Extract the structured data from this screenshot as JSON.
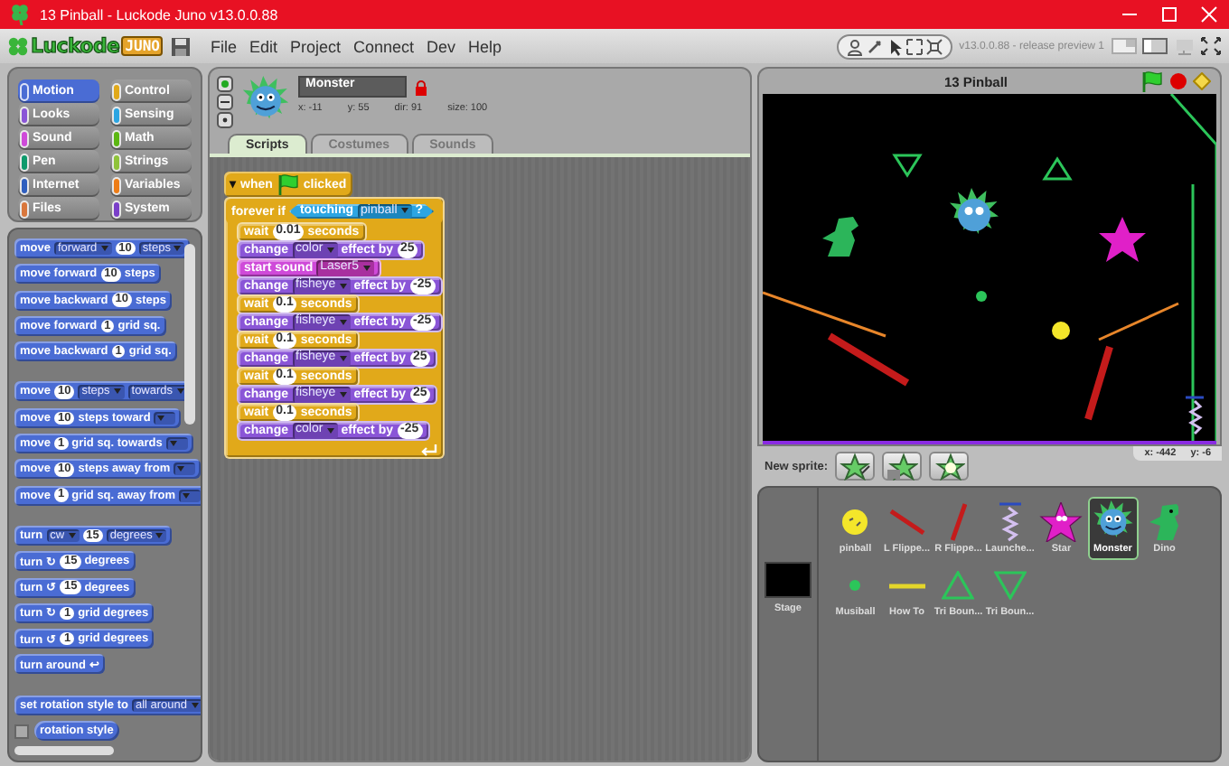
{
  "window": {
    "title": "13 Pinball - Luckode Juno v13.0.0.88"
  },
  "toolbar": {
    "logo": "Luckode",
    "logo_badge": "JUNO",
    "menu": [
      "File",
      "Edit",
      "Project",
      "Connect",
      "Dev",
      "Help"
    ],
    "version": "v13.0.0.88 - release preview 1"
  },
  "categories": [
    {
      "label": "Motion",
      "color": "#4a6cd4",
      "selected": true
    },
    {
      "label": "Control",
      "color": "#e1a91a",
      "selected": false
    },
    {
      "label": "Looks",
      "color": "#8a55d7",
      "selected": false
    },
    {
      "label": "Sensing",
      "color": "#2ca5e2",
      "selected": false
    },
    {
      "label": "Sound",
      "color": "#cf4ad9",
      "selected": false
    },
    {
      "label": "Math",
      "color": "#5cb712",
      "selected": false
    },
    {
      "label": "Pen",
      "color": "#0e9a6c",
      "selected": false
    },
    {
      "label": "Strings",
      "color": "#8fc33a",
      "selected": false
    },
    {
      "label": "Internet",
      "color": "#2f5fbf",
      "selected": false
    },
    {
      "label": "Variables",
      "color": "#ee7d16",
      "selected": false
    },
    {
      "label": "Files",
      "color": "#d9773c",
      "selected": false
    },
    {
      "label": "System",
      "color": "#7a3fc9",
      "selected": false
    }
  ],
  "palette": {
    "groups": [
      [
        {
          "kind": "motion",
          "parts": [
            {
              "kind": "label",
              "text": "move"
            },
            {
              "kind": "menu",
              "text": "forward"
            },
            {
              "kind": "number",
              "text": "10"
            },
            {
              "kind": "menu",
              "text": "steps"
            }
          ]
        },
        {
          "kind": "motion",
          "parts": [
            {
              "kind": "label",
              "text": "move forward"
            },
            {
              "kind": "number",
              "text": "10"
            },
            {
              "kind": "label",
              "text": "steps"
            }
          ]
        },
        {
          "kind": "motion",
          "parts": [
            {
              "kind": "label",
              "text": "move backward"
            },
            {
              "kind": "number",
              "text": "10"
            },
            {
              "kind": "label",
              "text": "steps"
            }
          ]
        },
        {
          "kind": "motion",
          "parts": [
            {
              "kind": "label",
              "text": "move forward"
            },
            {
              "kind": "number",
              "text": "1"
            },
            {
              "kind": "label",
              "text": "grid sq."
            }
          ]
        },
        {
          "kind": "motion",
          "parts": [
            {
              "kind": "label",
              "text": "move backward"
            },
            {
              "kind": "number",
              "text": "1"
            },
            {
              "kind": "label",
              "text": "grid sq."
            }
          ]
        }
      ],
      [
        {
          "kind": "motion",
          "parts": [
            {
              "kind": "label",
              "text": "move"
            },
            {
              "kind": "number",
              "text": "10"
            },
            {
              "kind": "menu",
              "text": "steps"
            },
            {
              "kind": "menu",
              "text": "towards"
            }
          ]
        },
        {
          "kind": "motion",
          "parts": [
            {
              "kind": "label",
              "text": "move"
            },
            {
              "kind": "number",
              "text": "10"
            },
            {
              "kind": "label",
              "text": "steps toward"
            },
            {
              "kind": "menu"
            }
          ]
        },
        {
          "kind": "motion",
          "parts": [
            {
              "kind": "label",
              "text": "move"
            },
            {
              "kind": "number",
              "text": "1"
            },
            {
              "kind": "label",
              "text": "grid sq. towards"
            },
            {
              "kind": "menu"
            }
          ]
        },
        {
          "kind": "motion",
          "parts": [
            {
              "kind": "label",
              "text": "move"
            },
            {
              "kind": "number",
              "text": "10"
            },
            {
              "kind": "label",
              "text": "steps away from"
            },
            {
              "kind": "menu"
            }
          ]
        },
        {
          "kind": "motion",
          "parts": [
            {
              "kind": "label",
              "text": "move"
            },
            {
              "kind": "number",
              "text": "1"
            },
            {
              "kind": "label",
              "text": "grid sq. away from"
            },
            {
              "kind": "menu"
            }
          ]
        }
      ],
      [
        {
          "kind": "motion",
          "parts": [
            {
              "kind": "label",
              "text": "turn"
            },
            {
              "kind": "menu",
              "text": "cw"
            },
            {
              "kind": "number",
              "text": "15"
            },
            {
              "kind": "menu",
              "text": "degrees"
            }
          ]
        },
        {
          "kind": "motion",
          "parts": [
            {
              "kind": "label",
              "text": "turn ↻"
            },
            {
              "kind": "number",
              "text": "15"
            },
            {
              "kind": "label",
              "text": "degrees"
            }
          ]
        },
        {
          "kind": "motion",
          "parts": [
            {
              "kind": "label",
              "text": "turn ↺"
            },
            {
              "kind": "number",
              "text": "15"
            },
            {
              "kind": "label",
              "text": "degrees"
            }
          ]
        },
        {
          "kind": "motion",
          "parts": [
            {
              "kind": "label",
              "text": "turn ↻"
            },
            {
              "kind": "number",
              "text": "1"
            },
            {
              "kind": "label",
              "text": "grid degrees"
            }
          ]
        },
        {
          "kind": "motion",
          "parts": [
            {
              "kind": "label",
              "text": "turn ↺"
            },
            {
              "kind": "number",
              "text": "1"
            },
            {
              "kind": "label",
              "text": "grid degrees"
            }
          ]
        },
        {
          "kind": "motion",
          "parts": [
            {
              "kind": "label",
              "text": "turn around ↩"
            }
          ]
        }
      ],
      [
        {
          "kind": "motion",
          "parts": [
            {
              "kind": "label",
              "text": "set rotation style to"
            },
            {
              "kind": "menu",
              "text": "all around"
            }
          ]
        },
        {
          "kind": "motion",
          "reporter": true,
          "checked": false,
          "parts": [
            {
              "kind": "label",
              "text": "rotation style"
            }
          ]
        }
      ]
    ]
  },
  "sprite": {
    "name": "Monster",
    "stats": [
      "x: -11",
      "y: 55",
      "dir: 91",
      "size: 100"
    ]
  },
  "tabs": [
    {
      "label": "Scripts",
      "selected": true
    },
    {
      "label": "Costumes",
      "selected": false
    },
    {
      "label": "Sounds",
      "selected": false
    }
  ],
  "script": {
    "hat": {
      "kind": "control",
      "parts": [
        {
          "kind": "glyph",
          "text": "▾"
        },
        {
          "kind": "label",
          "text": "when"
        },
        {
          "kind": "flag"
        },
        {
          "kind": "label",
          "text": "clicked"
        }
      ]
    },
    "loop": {
      "kind": "control",
      "parts": [
        {
          "kind": "label",
          "text": "forever if"
        },
        {
          "kind": "predicate",
          "parts": [
            {
              "kind": "label",
              "text": "touching"
            },
            {
              "kind": "menu",
              "text": "pinball"
            },
            {
              "kind": "label",
              "text": "?"
            }
          ]
        }
      ],
      "body": [
        {
          "kind": "control",
          "parts": [
            {
              "kind": "label",
              "text": "wait"
            },
            {
              "kind": "number",
              "text": "0.01"
            },
            {
              "kind": "label",
              "text": "seconds"
            }
          ]
        },
        {
          "kind": "looks",
          "parts": [
            {
              "kind": "label",
              "text": "change"
            },
            {
              "kind": "menu",
              "text": "color"
            },
            {
              "kind": "label",
              "text": "effect by"
            },
            {
              "kind": "number",
              "text": "25"
            }
          ]
        },
        {
          "kind": "sound",
          "parts": [
            {
              "kind": "label",
              "text": "start sound"
            },
            {
              "kind": "menu",
              "text": "Laser5"
            }
          ]
        },
        {
          "kind": "looks",
          "parts": [
            {
              "kind": "label",
              "text": "change"
            },
            {
              "kind": "menu",
              "text": "fisheye"
            },
            {
              "kind": "label",
              "text": "effect by"
            },
            {
              "kind": "number",
              "text": "-25"
            }
          ]
        },
        {
          "kind": "control",
          "parts": [
            {
              "kind": "label",
              "text": "wait"
            },
            {
              "kind": "number",
              "text": "0.1"
            },
            {
              "kind": "label",
              "text": "seconds"
            }
          ]
        },
        {
          "kind": "looks",
          "parts": [
            {
              "kind": "label",
              "text": "change"
            },
            {
              "kind": "menu",
              "text": "fisheye"
            },
            {
              "kind": "label",
              "text": "effect by"
            },
            {
              "kind": "number",
              "text": "-25"
            }
          ]
        },
        {
          "kind": "control",
          "parts": [
            {
              "kind": "label",
              "text": "wait"
            },
            {
              "kind": "number",
              "text": "0.1"
            },
            {
              "kind": "label",
              "text": "seconds"
            }
          ]
        },
        {
          "kind": "looks",
          "parts": [
            {
              "kind": "label",
              "text": "change"
            },
            {
              "kind": "menu",
              "text": "fisheye"
            },
            {
              "kind": "label",
              "text": "effect by"
            },
            {
              "kind": "number",
              "text": "25"
            }
          ]
        },
        {
          "kind": "control",
          "parts": [
            {
              "kind": "label",
              "text": "wait"
            },
            {
              "kind": "number",
              "text": "0.1"
            },
            {
              "kind": "label",
              "text": "seconds"
            }
          ]
        },
        {
          "kind": "looks",
          "parts": [
            {
              "kind": "label",
              "text": "change"
            },
            {
              "kind": "menu",
              "text": "fisheye"
            },
            {
              "kind": "label",
              "text": "effect by"
            },
            {
              "kind": "number",
              "text": "25"
            }
          ]
        },
        {
          "kind": "control",
          "parts": [
            {
              "kind": "label",
              "text": "wait"
            },
            {
              "kind": "number",
              "text": "0.1"
            },
            {
              "kind": "label",
              "text": "seconds"
            }
          ]
        },
        {
          "kind": "looks",
          "parts": [
            {
              "kind": "label",
              "text": "change"
            },
            {
              "kind": "menu",
              "text": "color"
            },
            {
              "kind": "label",
              "text": "effect by"
            },
            {
              "kind": "number",
              "text": "-25"
            }
          ]
        }
      ]
    }
  },
  "stage": {
    "title": "13 Pinball",
    "mouse": [
      "x: -442",
      "y: -6"
    ]
  },
  "new_sprite": {
    "label": "New sprite:"
  },
  "stage_thumb": {
    "label": "Stage"
  },
  "sprites": [
    {
      "name": "pinball",
      "kind": "ball",
      "selected": false
    },
    {
      "name": "L Flippe...",
      "kind": "bar-left",
      "selected": false
    },
    {
      "name": "R Flippe...",
      "kind": "bar-right",
      "selected": false
    },
    {
      "name": "Launche...",
      "kind": "spring",
      "selected": false
    },
    {
      "name": "Star",
      "kind": "star",
      "selected": false
    },
    {
      "name": "Monster",
      "kind": "monster",
      "selected": true
    },
    {
      "name": "Dino",
      "kind": "dino",
      "selected": false
    },
    {
      "name": "Musiball",
      "kind": "dot",
      "selected": false
    },
    {
      "name": "How To",
      "kind": "dash",
      "selected": false
    },
    {
      "name": "Tri Boun...",
      "kind": "tri-up",
      "selected": false
    },
    {
      "name": "Tri Boun...",
      "kind": "tri-down",
      "selected": false
    }
  ]
}
